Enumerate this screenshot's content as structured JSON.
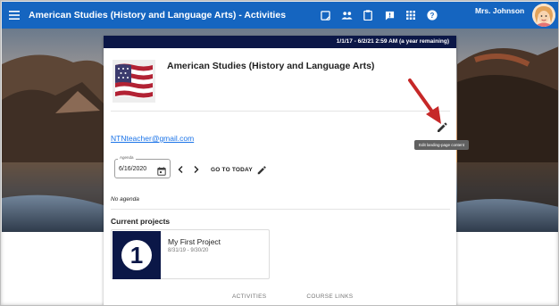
{
  "app_bar": {
    "title": "American Studies (History and Language Arts) - Activities",
    "icons": [
      "menu-icon",
      "note-icon",
      "people-icon",
      "clipboard-icon",
      "feedback-icon",
      "apps-icon",
      "help-icon"
    ],
    "user_name": "Mrs. Johnson",
    "color": "#1565c0"
  },
  "card": {
    "header_dates": "1/1/17 - 6/2/21 2:59 AM (a year remaining)",
    "course_title": "American Studies (History and Language Arts)",
    "email": "NTNteacher@gmail.com",
    "edit_tooltip": "Edit landing-page content",
    "header_color": "#0b1747"
  },
  "agenda": {
    "label": "Agenda",
    "date": "6/16/2020",
    "go_to_today": "GO TO TODAY",
    "empty_text": "No agenda"
  },
  "projects": {
    "heading": "Current projects",
    "items": [
      {
        "number": "1",
        "name": "My First Project",
        "dates": "8/31/19 - 9/30/20"
      }
    ]
  },
  "tabs": [
    "ACTIVITIES",
    "COURSE LINKS"
  ]
}
